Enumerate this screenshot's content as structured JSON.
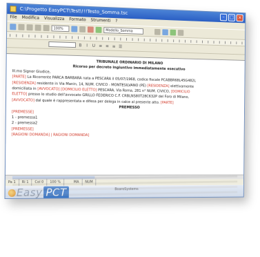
{
  "window": {
    "title": "C:\\Progetto EasyPCT\\Test\\!!!Testo_Somma.tsc"
  },
  "menu": [
    "File",
    "Modifica",
    "Visualizza",
    "Formato",
    "Strumenti",
    "?"
  ],
  "toolbar": {
    "zoom": "100%",
    "style": "Modello_Somma"
  },
  "document": {
    "heading": "TRIBUNALE ORDINARIO DI MILANO",
    "subheading": "Ricorso per decreto ingiuntivo immediatamente esecutivo",
    "salutation": "Ill.mo Signor Giudice,",
    "para1": [
      {
        "t": "[PARTE]",
        "tag": true
      },
      {
        "t": " La Ricorrente PARCA BARBARA nata a PESCARA il 05/07/1968, codice fiscale PCABBR68L45G482L",
        "tag": false
      }
    ],
    "para2": [
      {
        "t": "[RESIDENZA]",
        "tag": true
      },
      {
        "t": " residente in Via Manin, 14, NUM. CIVICO - MONTESILVANO (PE) ",
        "tag": false
      },
      {
        "t": "[RESIDENZA]",
        "tag": true
      },
      {
        "t": " elettivamente",
        "tag": false
      }
    ],
    "para3": [
      {
        "t": "domiciliata in ",
        "tag": false
      },
      {
        "t": "[AVVOCATO]",
        "tag": true
      },
      {
        "t": " ",
        "tag": false
      },
      {
        "t": "[DOMICILIO ELETTO]",
        "tag": true
      },
      {
        "t": " PESCARA, Via Roma, 281 n° NUM. CIVICO, ",
        "tag": false
      },
      {
        "t": "[DOMICILIO",
        "tag": true
      }
    ],
    "para4": [
      {
        "t": "ELETTO]",
        "tag": true
      },
      {
        "t": " presso lo studio dell'avvocato GRILLO FEDERICO C.F. CRBLNS80T28C632P del Foro di Milano,",
        "tag": false
      }
    ],
    "para5": [
      {
        "t": "[AVVOCATO]",
        "tag": true
      },
      {
        "t": " dal quale è rappresentata e difesa per delega in calce al presente atto. ",
        "tag": false
      },
      {
        "t": "[PARTE]",
        "tag": true
      }
    ],
    "premesso": "PREMESSO",
    "premesse_tag": "[PREMESSE]",
    "item1": "1 - premessa1",
    "item2": "2 - premessa2",
    "premesse_tag2": "[PREMESSE]",
    "last_line": "[RAGIONI DOMANDA] | RAGIONI DOMANDA]"
  },
  "status": {
    "page": "Pa  1",
    "line": "Ri  1",
    "col": "Col  0",
    "zoom": "100 %",
    "ma": "MA",
    "num": "NUM"
  },
  "brand": {
    "logo_text": "Easy",
    "logo_badge": "PCT",
    "company": "BoaroSystems"
  },
  "colors": {
    "title": "#2b5fc4",
    "tag": "#d23a2a"
  }
}
